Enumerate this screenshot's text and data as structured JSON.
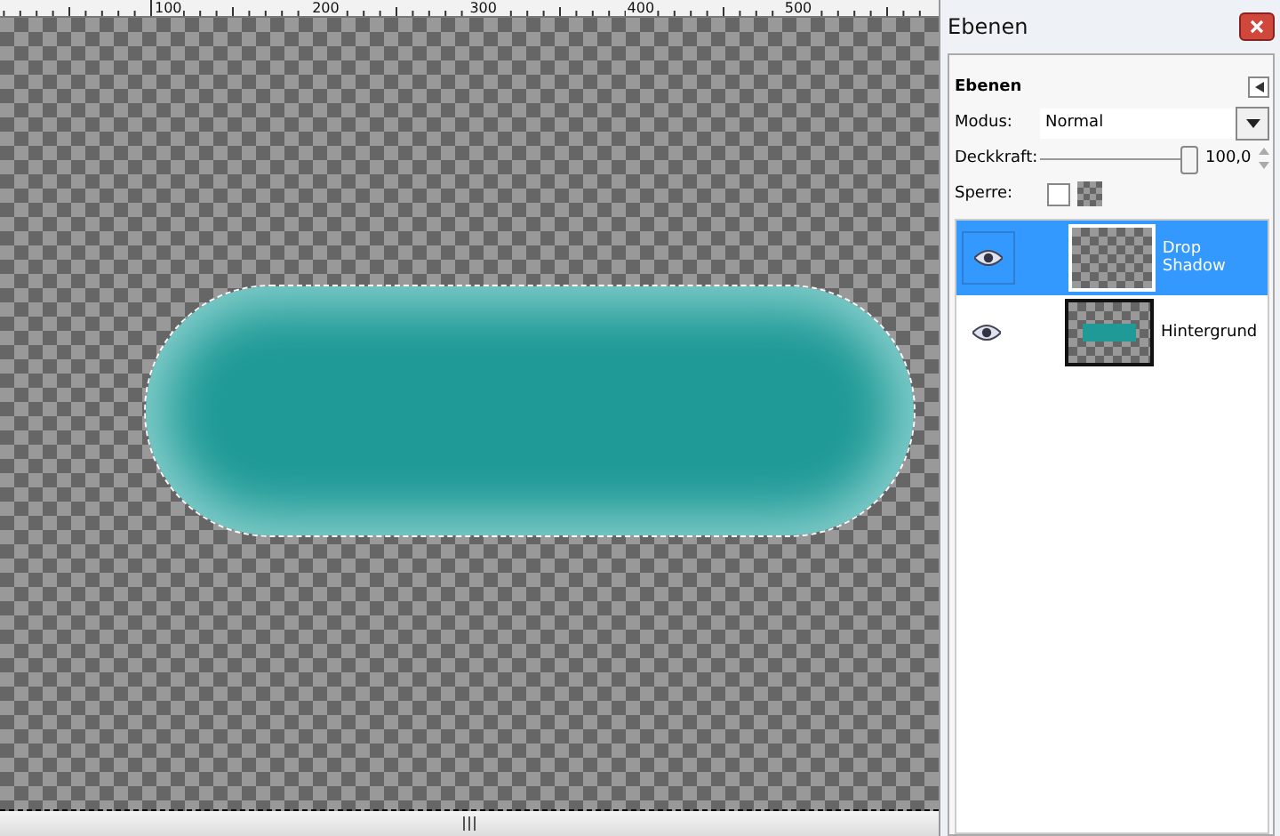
{
  "ruler": {
    "labels": [
      "100",
      "200",
      "300",
      "400",
      "500"
    ]
  },
  "dock": {
    "title": "Ebenen"
  },
  "layers_panel": {
    "heading": "Ebenen",
    "mode": {
      "label": "Modus:",
      "value": "Normal"
    },
    "opacity": {
      "label": "Deckkraft:",
      "level": 1.0,
      "reading": "100,0"
    },
    "lock": {
      "label": "Sperre:",
      "checked": false
    },
    "layers": [
      {
        "name": "Drop Shadow",
        "visible": true,
        "selected": true,
        "kind": "transparent"
      },
      {
        "name": "Hintergrund",
        "visible": true,
        "selected": false,
        "kind": "pill"
      }
    ]
  }
}
